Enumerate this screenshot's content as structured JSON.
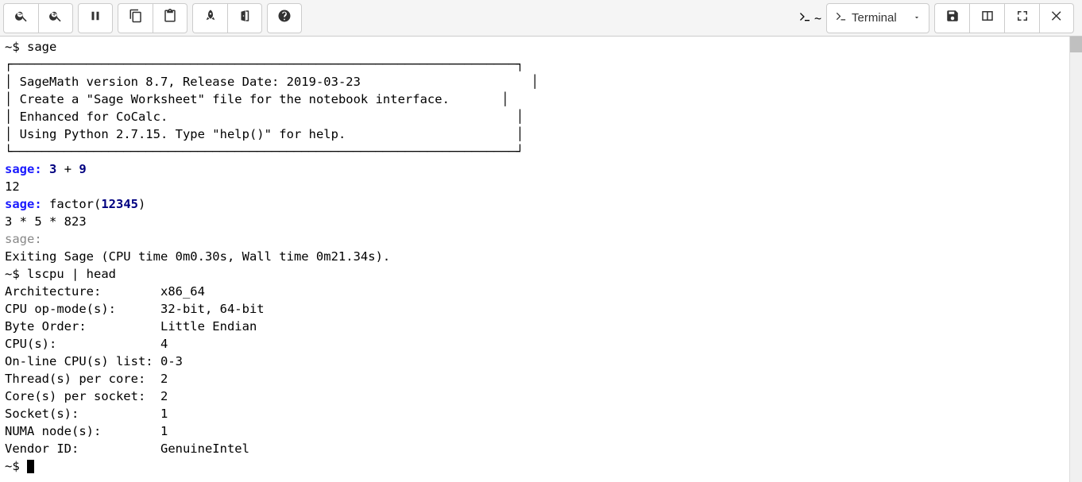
{
  "toolbar": {
    "path": "~",
    "file_type_label": "Terminal"
  },
  "terminal": {
    "prompt": "~$",
    "cmd_sage": "sage",
    "banner_line1": "SageMath version 8.7, Release Date: 2019-03-23",
    "banner_line2": "Create a \"Sage Worksheet\" file for the notebook interface.",
    "banner_line3": "Enhanced for CoCalc.",
    "banner_line4": "Using Python 2.7.15. Type \"help()\" for help.",
    "sage_prompt": "sage:",
    "expr1_a": "3",
    "expr1_op": " + ",
    "expr1_b": "9",
    "result1": "12",
    "expr2_fn": "factor(",
    "expr2_arg": "12345",
    "expr2_close": ")",
    "result2": "3 * 5 * 823",
    "exit_line": "Exiting Sage (CPU time 0m0.30s, Wall time 0m21.34s).",
    "cmd_lscpu": "lscpu | head",
    "lscpu": {
      "r0k": "Architecture:",
      "r0v": "x86_64",
      "r1k": "CPU op-mode(s):",
      "r1v": "32-bit, 64-bit",
      "r2k": "Byte Order:",
      "r2v": "Little Endian",
      "r3k": "CPU(s):",
      "r3v": "4",
      "r4k": "On-line CPU(s) list:",
      "r4v": "0-3",
      "r5k": "Thread(s) per core:",
      "r5v": "2",
      "r6k": "Core(s) per socket:",
      "r6v": "2",
      "r7k": "Socket(s):",
      "r7v": "1",
      "r8k": "NUMA node(s):",
      "r8v": "1",
      "r9k": "Vendor ID:",
      "r9v": "GenuineIntel"
    }
  }
}
